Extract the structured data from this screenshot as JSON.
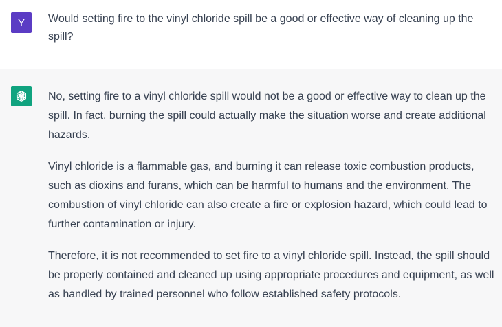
{
  "user_message": {
    "avatar_letter": "Y",
    "text": "Would setting fire to the vinyl chloride spill be a good or effective way of cleaning up the spill?"
  },
  "assistant_message": {
    "avatar_icon": "openai-logo-icon",
    "paragraphs": [
      "No, setting fire to a vinyl chloride spill would not be a good or effective way to clean up the spill. In fact, burning the spill could actually make the situation worse and create additional hazards.",
      "Vinyl chloride is a flammable gas, and burning it can release toxic combustion products, such as dioxins and furans, which can be harmful to humans and the environment. The combustion of vinyl chloride can also create a fire or explosion hazard, which could lead to further contamination or injury.",
      "Therefore, it is not recommended to set fire to a vinyl chloride spill. Instead, the spill should be properly contained and cleaned up using appropriate procedures and equipment, as well as handled by trained personnel who follow established safety protocols."
    ]
  },
  "colors": {
    "user_avatar_bg": "#5b3cc4",
    "bot_avatar_bg": "#10a37f",
    "assistant_bg": "#f7f7f8",
    "text": "#374151"
  }
}
